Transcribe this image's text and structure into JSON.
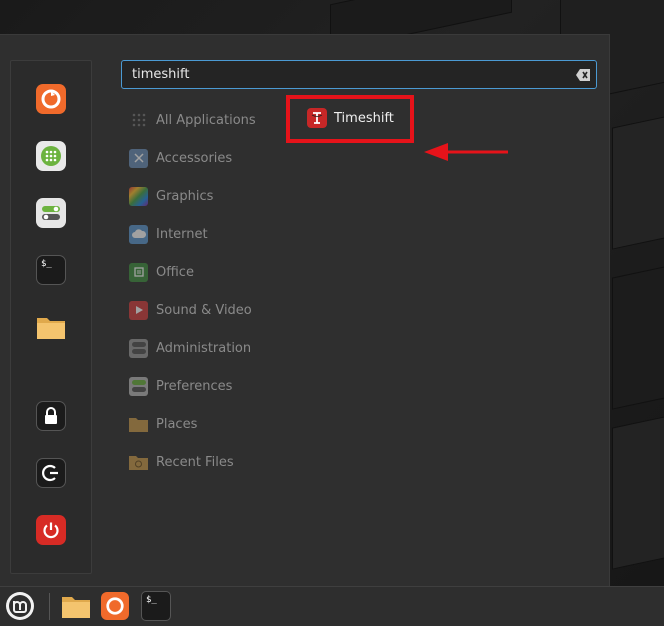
{
  "search": {
    "value": "timeshift"
  },
  "categories": [
    {
      "label": "All Applications",
      "icon": "grid-icon"
    },
    {
      "label": "Accessories",
      "icon": "scissors-icon"
    },
    {
      "label": "Graphics",
      "icon": "palette-icon"
    },
    {
      "label": "Internet",
      "icon": "cloud-icon"
    },
    {
      "label": "Office",
      "icon": "office-icon"
    },
    {
      "label": "Sound & Video",
      "icon": "play-icon"
    },
    {
      "label": "Administration",
      "icon": "toggle-icon"
    },
    {
      "label": "Preferences",
      "icon": "toggle-icon"
    },
    {
      "label": "Places",
      "icon": "folder-icon"
    },
    {
      "label": "Recent Files",
      "icon": "recent-folder-icon"
    }
  ],
  "result": {
    "label": "Timeshift",
    "icon": "timeshift-icon"
  },
  "favorites": [
    "firefox-icon",
    "software-manager-icon",
    "settings-icon",
    "terminal-icon",
    "files-icon",
    "lock-icon",
    "logout-icon",
    "power-icon"
  ],
  "taskbar": [
    "mint-menu-icon",
    "files-icon",
    "firefox-icon",
    "terminal-icon"
  ],
  "colors": {
    "accent": "#4b9ad3",
    "highlight": "#e6131a",
    "firefox": "#f06a2b",
    "power": "#d72b25"
  }
}
